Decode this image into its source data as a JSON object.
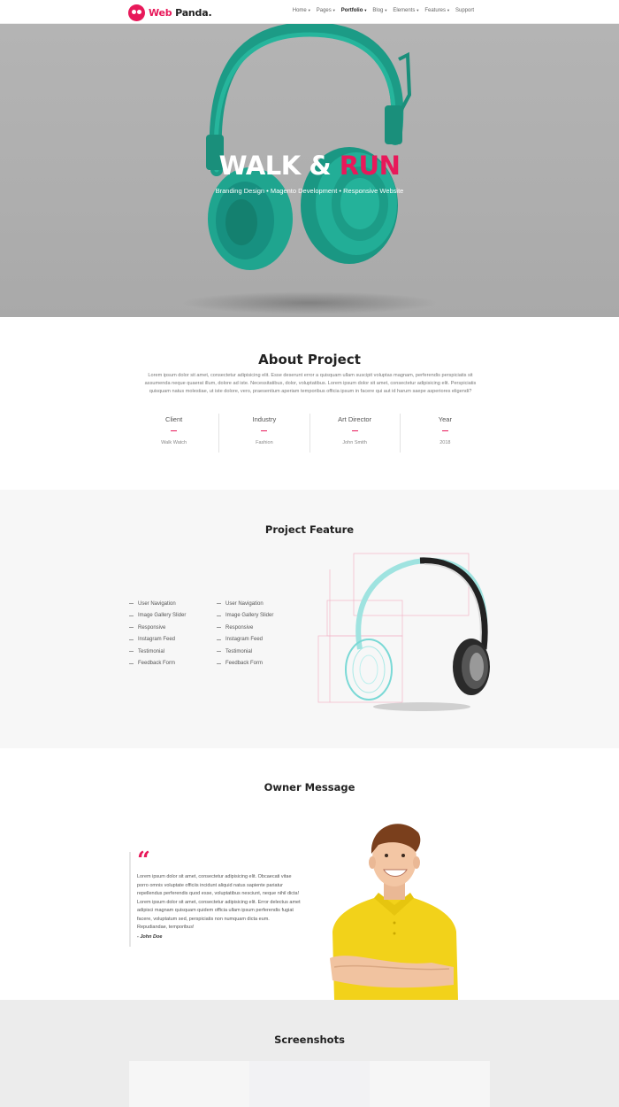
{
  "nav": {
    "logo_part1": "Web",
    "logo_part2": "Panda.",
    "items": [
      {
        "label": "Home",
        "caret": true
      },
      {
        "label": "Pages",
        "caret": true
      },
      {
        "label": "Portfolio",
        "caret": true,
        "active": true
      },
      {
        "label": "Blog",
        "caret": true
      },
      {
        "label": "Elements",
        "caret": true
      },
      {
        "label": "Features",
        "caret": true
      },
      {
        "label": "Support",
        "caret": false
      }
    ]
  },
  "hero": {
    "title_part1": "WALK & ",
    "title_part2": "RUN",
    "subtitle": "Branding Design • Magento Development • Responsive Website",
    "colors": {
      "background": "#b0b0b0",
      "headphone": "#1fa58f",
      "accent": "#e8195a"
    }
  },
  "about": {
    "title": "About Project",
    "text": "Lorem ipsum dolor sit amet, consectetur adipisicing elit. Esse deserunt error a quisquam ullam suscipit voluptas magnam, perferendis perspiciatis sit assumenda neque quaerat illum, dolore ad iste. Necessitatibus, dolor, voluptatibus. Lorem ipsum dolor sit amet, consectetur adipisicing elit. Perspiciatis quisquam natus molestiae, ut iste dolore, vero, praesentium aperiam temporibus officia ipsum in facere qui aut id harum saepe asperiores eligendi?",
    "stats": [
      {
        "label": "Client",
        "value": "Walk Watch"
      },
      {
        "label": "Industry",
        "value": "Fashion"
      },
      {
        "label": "Art Director",
        "value": "John Smith"
      },
      {
        "label": "Year",
        "value": "2018"
      }
    ]
  },
  "feature": {
    "title": "Project Feature",
    "list1": [
      "User Navigation",
      "Image Gallery Slider",
      "Responsive",
      "Instagram Feed",
      "Testimonial",
      "Feedback Form"
    ],
    "list2": [
      "User Navigation",
      "Image Gallery Slider",
      "Responsive",
      "Instagram Feed",
      "Testimonial",
      "Feedback Form"
    ]
  },
  "owner": {
    "title": "Owner Message",
    "quote_mark": "“",
    "quote": "Lorem ipsum dolor sit amet, consectetur adipisicing elit. Obcaecati vitae porro omnis voluptate officiis incidunt aliquid natus sapiente pariatur repellendus perferendis quod esse, voluptatibus nesciunt, neque nihil dicta! Lorem ipsum dolor sit amet, consectetur adipisicing elit. Error delectus amet adipisci magnam quisquam quidem officia ullam ipsum perferendis fugiat facere, voluptatum sed, perspiciatis non numquam dicta eum. Repudiandae, temporibus!",
    "author": "- John Doe"
  },
  "screenshots": {
    "title": "Screenshots"
  }
}
